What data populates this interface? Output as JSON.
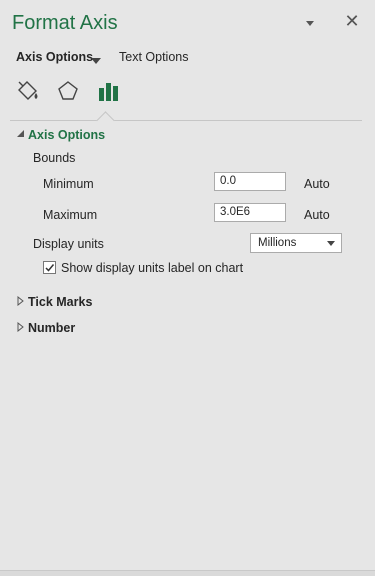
{
  "pane": {
    "title": "Format Axis",
    "close_glyph": "✕",
    "icons": {
      "dropdown": "chevron-down-icon",
      "close": "close-icon"
    }
  },
  "tabs": {
    "axis_options": "Axis Options",
    "text_options": "Text Options",
    "active": "axis_options"
  },
  "category_icons": [
    "fill-line-icon",
    "effects-pentagon-icon",
    "axis-options-bar-chart-icon"
  ],
  "sections": {
    "axis_options": {
      "label": "Axis Options",
      "expanded": true,
      "bounds_label": "Bounds",
      "minimum": {
        "label": "Minimum",
        "value": "0.0",
        "auto_label": "Auto"
      },
      "maximum": {
        "label": "Maximum",
        "value": "3.0E6",
        "auto_label": "Auto"
      },
      "display_units": {
        "label": "Display units",
        "selected": "Millions"
      },
      "show_units_label": {
        "label": "Show display units label on chart",
        "checked": true
      }
    },
    "tick_marks": {
      "label": "Tick Marks",
      "expanded": false
    },
    "number": {
      "label": "Number",
      "expanded": false
    }
  },
  "colors": {
    "accent": "#217346",
    "background": "#e6e6e6",
    "bar_icon": "#217346"
  }
}
